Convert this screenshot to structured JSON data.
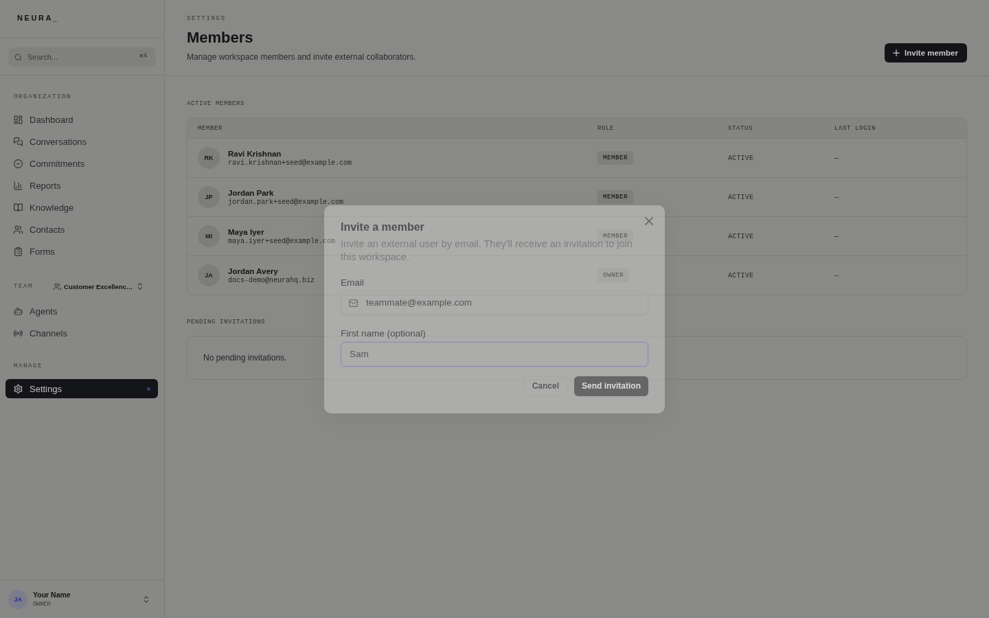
{
  "sidebar": {
    "logo": "NEURA_",
    "search": {
      "placeholder": "Search...",
      "shortcut": "⌘K"
    },
    "sections": [
      {
        "label": "ORGANIZATION",
        "items": [
          {
            "label": "Dashboard",
            "selected": false
          },
          {
            "label": "Conversations",
            "selected": false
          },
          {
            "label": "Commitments",
            "selected": false
          },
          {
            "label": "Reports",
            "selected": false
          },
          {
            "label": "Knowledge",
            "selected": false
          },
          {
            "label": "Contacts",
            "selected": false
          },
          {
            "label": "Forms",
            "selected": false
          }
        ]
      },
      {
        "label": "TEAM",
        "team_selector": "Customer Excellenc…",
        "items": [
          {
            "label": "Agents",
            "selected": false
          },
          {
            "label": "Channels",
            "selected": false
          }
        ]
      },
      {
        "label": "MANAGE",
        "items": [
          {
            "label": "Settings",
            "selected": true
          }
        ]
      }
    ],
    "user": {
      "initials": "JA",
      "name": "Your Name",
      "role": "OWNER"
    }
  },
  "main": {
    "breadcrumb": "SETTINGS",
    "title": "Members",
    "description": "Manage workspace members and invite external collaborators.",
    "invite_button": "Invite member",
    "active_members": {
      "label": "ACTIVE MEMBERS",
      "columns": [
        "MEMBER",
        "ROLE",
        "STATUS",
        "LAST LOGIN"
      ],
      "rows": [
        {
          "initials": "RK",
          "name": "Ravi Krishnan",
          "email": "ravi.krishnan+seed@example.com",
          "role": "MEMBER",
          "status": "ACTIVE",
          "last_login": "—"
        },
        {
          "initials": "JP",
          "name": "Jordan Park",
          "email": "jordan.park+seed@example.com",
          "role": "MEMBER",
          "status": "ACTIVE",
          "last_login": "—"
        },
        {
          "initials": "MI",
          "name": "Maya Iyer",
          "email": "maya.iyer+seed@example.com",
          "role": "MEMBER",
          "status": "ACTIVE",
          "last_login": "—"
        },
        {
          "initials": "JA",
          "name": "Jordan Avery",
          "email": "docs-demo@neurahq.biz",
          "role": "OWNER",
          "status": "ACTIVE",
          "last_login": "—"
        }
      ]
    },
    "pending": {
      "label": "PENDING INVITATIONS",
      "empty_text": "No pending invitations."
    }
  },
  "modal": {
    "title": "Invite a member",
    "description": "Invite an external user by email. They'll receive an invitation to join this workspace.",
    "fields": [
      {
        "kind": "email",
        "label": "Email",
        "placeholder": "teammate@example.com",
        "focused": false
      },
      {
        "kind": "text",
        "label": "First name (optional)",
        "placeholder": "Sam",
        "focused": true
      }
    ],
    "buttons": [
      {
        "label": "Cancel",
        "kind": "secondary"
      },
      {
        "label": "Send invitation",
        "kind": "primary"
      }
    ]
  }
}
